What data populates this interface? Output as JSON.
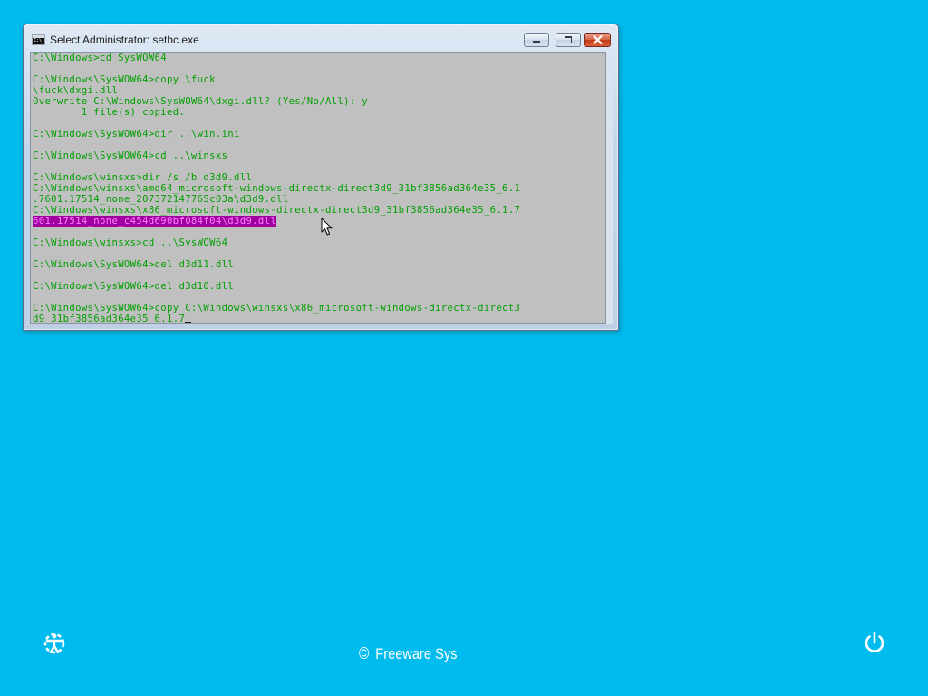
{
  "window": {
    "title": "Select Administrator: sethc.exe"
  },
  "console": {
    "lines": [
      "C:\\Windows>cd SysWOW64",
      "",
      "C:\\Windows\\SysWOW64>copy \\fuck",
      "\\fuck\\dxgi.dll",
      "Overwrite C:\\Windows\\SysWOW64\\dxgi.dll? (Yes/No/All): y",
      "        1 file(s) copied.",
      "",
      "C:\\Windows\\SysWOW64>dir ..\\win.ini",
      "",
      "C:\\Windows\\SysWOW64>cd ..\\winsxs",
      "",
      "C:\\Windows\\winsxs>dir /s /b d3d9.dll",
      "C:\\Windows\\winsxs\\amd64_microsoft-windows-directx-direct3d9_31bf3856ad364e35_6.1",
      ".7601.17514_none_20737214776Sc03a\\d3d9.dll",
      "C:\\Windows\\winsxs\\x86_microsoft-windows-directx-direct3d9_31bf3856ad364e35_6.1.7",
      "601.17514_none_c454d690bf084f04\\d3d9.dll",
      "",
      "C:\\Windows\\winsxs>cd ..\\SysWOW64",
      "",
      "C:\\Windows\\SysWOW64>del d3d11.dll",
      "",
      "C:\\Windows\\SysWOW64>del d3d10.dll",
      "",
      "C:\\Windows\\SysWOW64>copy C:\\Windows\\winsxs\\x86_microsoft-windows-directx-direct3",
      "d9_31bf3856ad364e35_6.1.7"
    ],
    "selected_line_index": 15,
    "text_color": "#00a000",
    "background_color": "#c0c0c0",
    "selection_color": "#a000a0"
  },
  "footer": {
    "brand_symbol": "©",
    "brand_text": "Freeware Sys"
  },
  "icons": {
    "left": "ease-of-access-icon",
    "right": "power-icon"
  },
  "desktop": {
    "background_color": "#00bbee"
  }
}
